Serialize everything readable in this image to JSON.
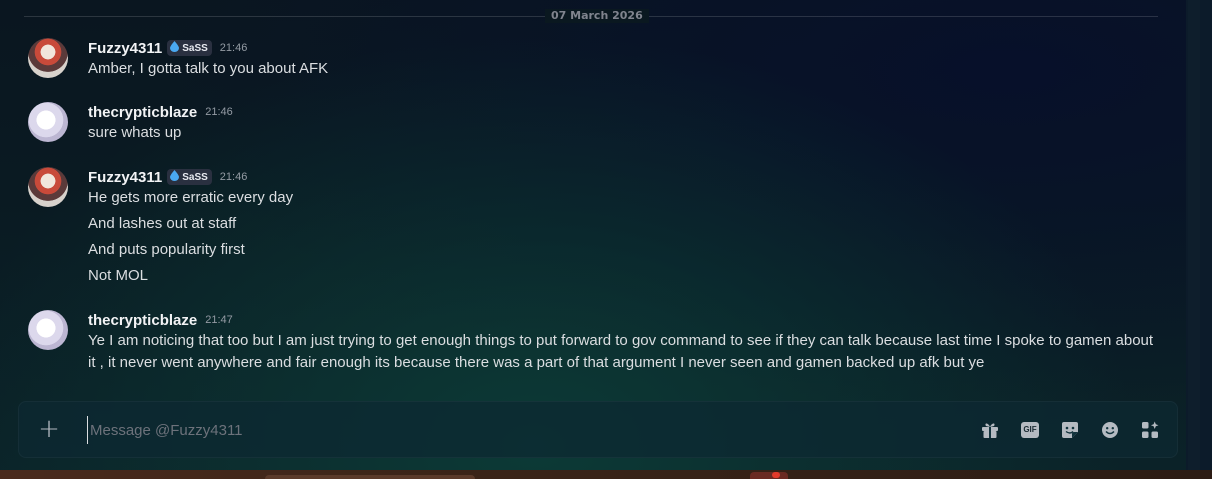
{
  "divider": {
    "date": "07 March 2026"
  },
  "messages": [
    {
      "username": "Fuzzy4311",
      "tag": "SaSS",
      "time": "21:46",
      "lines": [
        "Amber, I gotta talk to you about AFK"
      ]
    },
    {
      "username": "thecrypticblaze",
      "time": "21:46",
      "lines": [
        "sure whats up"
      ]
    },
    {
      "username": "Fuzzy4311",
      "tag": "SaSS",
      "time": "21:46",
      "lines": [
        "He gets more erratic every day",
        "And lashes out at staff",
        "And puts popularity first",
        "Not MOL"
      ]
    },
    {
      "username": "thecrypticblaze",
      "time": "21:47",
      "lines": [
        "Ye I am noticing that too but I am just trying to get enough things to put forward to gov command to see if they can talk because last time I spoke to gamen about it , it never went anywhere and fair enough its because there was a part of that argument I never seen and gamen backed up afk but ye"
      ]
    }
  ],
  "composer": {
    "placeholder": "Message @Fuzzy4311",
    "gif_label": "GIF",
    "icons": [
      "plus-icon",
      "gift-icon",
      "gif-icon",
      "sticker-icon",
      "emoji-icon",
      "apps-icon"
    ]
  },
  "colors": {
    "tag_icon": "#4aa8f0",
    "username": "#f2f3f5",
    "time": "#949ba4"
  }
}
